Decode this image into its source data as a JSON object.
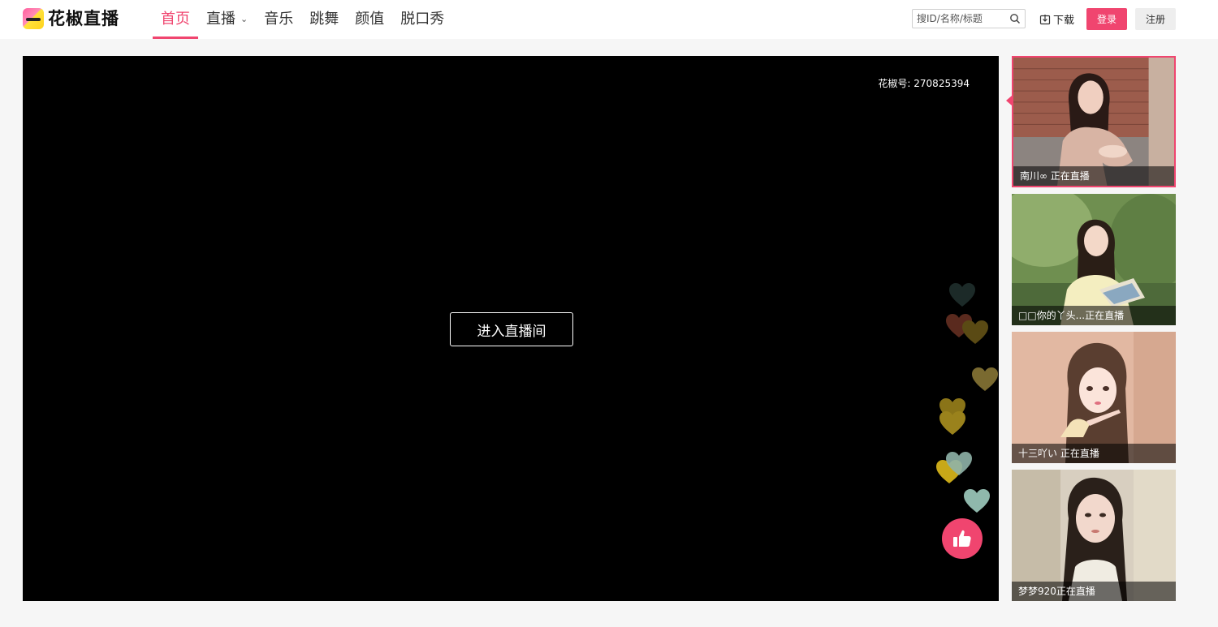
{
  "header": {
    "logo_text": "花椒直播",
    "nav": [
      {
        "label": "首页",
        "active": true
      },
      {
        "label": "直播",
        "has_dropdown": true
      },
      {
        "label": "音乐"
      },
      {
        "label": "跳舞"
      },
      {
        "label": "颜值"
      },
      {
        "label": "脱口秀"
      }
    ],
    "search_placeholder": "搜ID/名称/标题",
    "download_label": "下载",
    "login_label": "登录",
    "register_label": "注册",
    "accent_color": "#f0456f"
  },
  "player": {
    "room_id": "花椒号: 270825394",
    "enter_label": "进入直播间",
    "like_icon": "thumbs-up-icon"
  },
  "side_list": [
    {
      "caption": "南川∞ 正在直播",
      "active": true
    },
    {
      "caption": "□□你的丫头...正在直播"
    },
    {
      "caption": "十三吖い 正在直播"
    },
    {
      "caption": "梦梦920正在直播"
    }
  ]
}
